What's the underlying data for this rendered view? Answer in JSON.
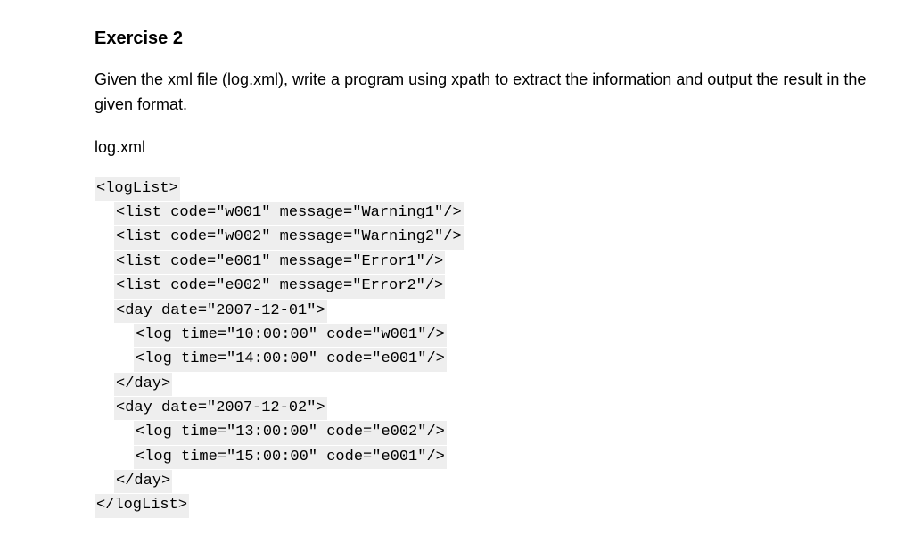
{
  "heading": "Exercise 2",
  "description": "Given the xml file (log.xml), write a program using xpath to extract the information and output the result in the given format.",
  "filename": "log.xml",
  "code_lines": [
    {
      "indent": 0,
      "text": "<logList>"
    },
    {
      "indent": 1,
      "text": "<list code=\"w001\" message=\"Warning1\"/>"
    },
    {
      "indent": 1,
      "text": "<list code=\"w002\" message=\"Warning2\"/>"
    },
    {
      "indent": 1,
      "text": "<list code=\"e001\" message=\"Error1\"/>"
    },
    {
      "indent": 1,
      "text": "<list code=\"e002\" message=\"Error2\"/>"
    },
    {
      "indent": 1,
      "text": "<day date=\"2007-12-01\">"
    },
    {
      "indent": 2,
      "text": "<log time=\"10:00:00\" code=\"w001\"/>"
    },
    {
      "indent": 2,
      "text": "<log time=\"14:00:00\" code=\"e001\"/>"
    },
    {
      "indent": 1,
      "text": "</day>"
    },
    {
      "indent": 1,
      "text": "<day date=\"2007-12-02\">"
    },
    {
      "indent": 2,
      "text": "<log time=\"13:00:00\" code=\"e002\"/>"
    },
    {
      "indent": 2,
      "text": "<log time=\"15:00:00\" code=\"e001\"/>"
    },
    {
      "indent": 1,
      "text": "</day>"
    },
    {
      "indent": 0,
      "text": "</logList>"
    }
  ]
}
